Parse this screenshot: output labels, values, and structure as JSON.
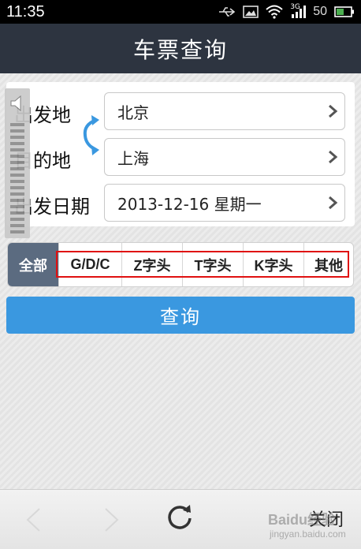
{
  "status_bar": {
    "time": "11:35",
    "network_label": "3G",
    "battery_percent": "50",
    "icons": [
      "usb-icon",
      "image-icon",
      "wifi-icon",
      "signal-icon",
      "battery-icon"
    ]
  },
  "header": {
    "title": "车票查询"
  },
  "form": {
    "from_label": "出发地",
    "from_value": "北京",
    "to_label": "目的地",
    "to_value": "上海",
    "date_label": "出发日期",
    "date_value": "2013-12-16 星期一"
  },
  "filter_tabs": [
    {
      "label": "全部",
      "selected": true
    },
    {
      "label": "G/D/C",
      "selected": false
    },
    {
      "label": "Z字头",
      "selected": false
    },
    {
      "label": "T字头",
      "selected": false
    },
    {
      "label": "K字头",
      "selected": false
    },
    {
      "label": "其他",
      "selected": false
    }
  ],
  "query_button": {
    "label": "查询"
  },
  "toolbar": {
    "close_label": "关闭",
    "icons": [
      "back-arrow-icon",
      "forward-arrow-icon",
      "refresh-icon"
    ]
  },
  "watermark": {
    "brand": "Baidu经验",
    "url": "jingyan.baidu.com"
  },
  "colors": {
    "header_bg": "#2d3440",
    "accent_blue": "#3a98e0",
    "selected_tab_bg": "#5b6b80",
    "highlight_red": "#e01010"
  }
}
